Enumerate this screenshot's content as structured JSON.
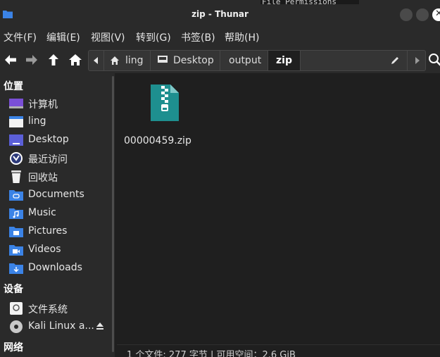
{
  "window": {
    "title": "zip - Thunar",
    "behind_text": "File Permissions"
  },
  "menu": [
    "文件(F)",
    "编辑(E)",
    "视图(V)",
    "转到(G)",
    "书签(B)",
    "帮助(H)"
  ],
  "path": {
    "segments": [
      "ling",
      "Desktop",
      "output",
      "zip"
    ]
  },
  "sidebar": {
    "sections": {
      "places": "位置",
      "devices": "设备",
      "network": "网络"
    },
    "places": [
      {
        "label": "计算机",
        "icon": "computer-icon"
      },
      {
        "label": "ling",
        "icon": "home-folder-icon"
      },
      {
        "label": "Desktop",
        "icon": "desktop-icon"
      },
      {
        "label": "最近访问",
        "icon": "recent-icon"
      },
      {
        "label": "回收站",
        "icon": "trash-icon"
      },
      {
        "label": "Documents",
        "icon": "documents-folder-icon"
      },
      {
        "label": "Music",
        "icon": "music-folder-icon"
      },
      {
        "label": "Pictures",
        "icon": "pictures-folder-icon"
      },
      {
        "label": "Videos",
        "icon": "videos-folder-icon"
      },
      {
        "label": "Downloads",
        "icon": "downloads-folder-icon"
      }
    ],
    "devices": [
      {
        "label": "文件系统",
        "icon": "filesystem-icon"
      },
      {
        "label": "Kali Linux a...",
        "icon": "disc-icon"
      }
    ]
  },
  "files": [
    {
      "name": "00000459.zip",
      "icon": "zip-archive-icon"
    }
  ],
  "status": "1 个文件: 277 字节 | 可用空间：2.6 GiB",
  "colors": {
    "accent": "#3b83e6",
    "zip": "#1e8f8f",
    "panel": "#2a2a2a",
    "background": "#1f1f1f"
  }
}
